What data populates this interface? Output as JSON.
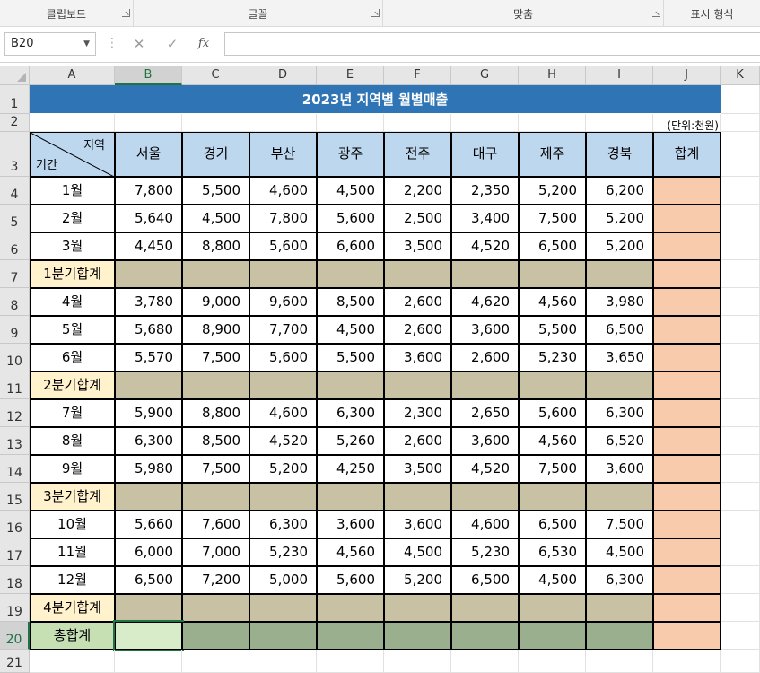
{
  "ribbon": {
    "groups": [
      {
        "label": "클립보드"
      },
      {
        "label": "글꼴"
      },
      {
        "label": "맞춤"
      },
      {
        "label": "표시 형식"
      }
    ]
  },
  "formula_bar": {
    "name_box": "B20",
    "cancel_icon": "✕",
    "enter_icon": "✓",
    "fx_label": "fx",
    "formula": ""
  },
  "columns": [
    "A",
    "B",
    "C",
    "D",
    "E",
    "F",
    "G",
    "H",
    "I",
    "J",
    "K"
  ],
  "rows": [
    "1",
    "2",
    "3",
    "4",
    "5",
    "6",
    "7",
    "8",
    "9",
    "10",
    "11",
    "12",
    "13",
    "14",
    "15",
    "16",
    "17",
    "18",
    "19",
    "20",
    "21"
  ],
  "sheet": {
    "title": "2023년 지역별 월별매출",
    "unit": "(단위:천원)",
    "header_region": "지역",
    "header_period": "기간",
    "regions": [
      "서울",
      "경기",
      "부산",
      "광주",
      "전주",
      "대구",
      "제주",
      "경북"
    ],
    "total_header": "합계",
    "data_rows": [
      {
        "label": "1월",
        "values": [
          "7,800",
          "5,500",
          "4,600",
          "4,500",
          "2,200",
          "2,350",
          "5,200",
          "6,200"
        ]
      },
      {
        "label": "2월",
        "values": [
          "5,640",
          "4,500",
          "7,800",
          "5,600",
          "2,500",
          "3,400",
          "7,500",
          "5,200"
        ]
      },
      {
        "label": "3월",
        "values": [
          "4,450",
          "8,800",
          "5,600",
          "6,600",
          "3,500",
          "4,520",
          "6,500",
          "5,200"
        ]
      },
      {
        "label": "1분기합계",
        "values": [
          "",
          "",
          "",
          "",
          "",
          "",
          "",
          ""
        ]
      },
      {
        "label": "4월",
        "values": [
          "3,780",
          "9,000",
          "9,600",
          "8,500",
          "2,600",
          "4,620",
          "4,560",
          "3,980"
        ]
      },
      {
        "label": "5월",
        "values": [
          "5,680",
          "8,900",
          "7,700",
          "4,500",
          "2,600",
          "3,600",
          "5,500",
          "6,500"
        ]
      },
      {
        "label": "6월",
        "values": [
          "5,570",
          "7,500",
          "5,600",
          "5,500",
          "3,600",
          "2,600",
          "5,230",
          "3,650"
        ]
      },
      {
        "label": "2분기합계",
        "values": [
          "",
          "",
          "",
          "",
          "",
          "",
          "",
          ""
        ]
      },
      {
        "label": "7월",
        "values": [
          "5,900",
          "8,800",
          "4,600",
          "6,300",
          "2,300",
          "2,650",
          "5,600",
          "6,300"
        ]
      },
      {
        "label": "8월",
        "values": [
          "6,300",
          "8,500",
          "4,520",
          "5,260",
          "2,600",
          "3,600",
          "4,560",
          "6,520"
        ]
      },
      {
        "label": "9월",
        "values": [
          "5,980",
          "7,500",
          "5,200",
          "4,250",
          "3,500",
          "4,520",
          "7,500",
          "3,600"
        ]
      },
      {
        "label": "3분기합계",
        "values": [
          "",
          "",
          "",
          "",
          "",
          "",
          "",
          ""
        ]
      },
      {
        "label": "10월",
        "values": [
          "5,660",
          "7,600",
          "6,300",
          "3,600",
          "3,600",
          "4,600",
          "6,500",
          "7,500"
        ]
      },
      {
        "label": "11월",
        "values": [
          "6,000",
          "7,000",
          "5,230",
          "4,560",
          "4,500",
          "5,230",
          "6,530",
          "4,500"
        ]
      },
      {
        "label": "12월",
        "values": [
          "6,500",
          "7,200",
          "5,000",
          "5,600",
          "5,200",
          "6,500",
          "4,500",
          "6,300"
        ]
      },
      {
        "label": "4분기합계",
        "values": [
          "",
          "",
          "",
          "",
          "",
          "",
          "",
          ""
        ]
      },
      {
        "label": "총합계",
        "values": [
          "",
          "",
          "",
          "",
          "",
          "",
          "",
          ""
        ]
      }
    ]
  },
  "colors": {
    "title_bg": "#2f75b5",
    "header_bg": "#bdd7ee",
    "total_col_bg": "#f8cbad",
    "quarter_label_bg": "#fff2cc",
    "quarter_row_bg": "#c9c1a4",
    "grand_label_bg": "#c6e0b4",
    "grand_sel_bg": "#d8ecc9",
    "grand_row_bg": "#9aaf8e"
  }
}
